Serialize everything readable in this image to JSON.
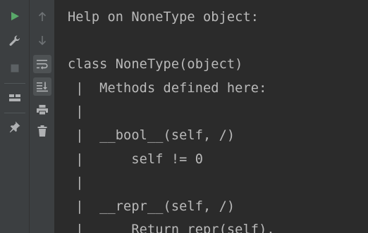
{
  "toolbar": {
    "buttons": [
      {
        "name": "run-icon",
        "tooltip": ""
      },
      {
        "name": "wrench-icon",
        "tooltip": ""
      },
      {
        "name": "stop-icon",
        "tooltip": ""
      },
      {
        "name": "layout-icon",
        "tooltip": ""
      },
      {
        "name": "pin-icon",
        "tooltip": ""
      }
    ],
    "secondary": [
      {
        "name": "arrow-up-icon"
      },
      {
        "name": "arrow-down-icon"
      },
      {
        "name": "soft-wrap-icon"
      },
      {
        "name": "scroll-to-end-icon"
      },
      {
        "name": "print-icon"
      },
      {
        "name": "trash-icon"
      }
    ]
  },
  "console": {
    "lines": [
      "Help on NoneType object:",
      "",
      "class NoneType(object)",
      " |  Methods defined here:",
      " |",
      " |  __bool__(self, /)",
      " |      self != 0",
      " |",
      " |  __repr__(self, /)",
      " |      Return repr(self)."
    ]
  },
  "colors": {
    "background": "#2b2b2b",
    "toolbar": "#3c3f41",
    "text": "#bababa",
    "run_green": "#59a869",
    "icon_gray": "#afb1b3",
    "icon_dim": "#5c6164"
  }
}
